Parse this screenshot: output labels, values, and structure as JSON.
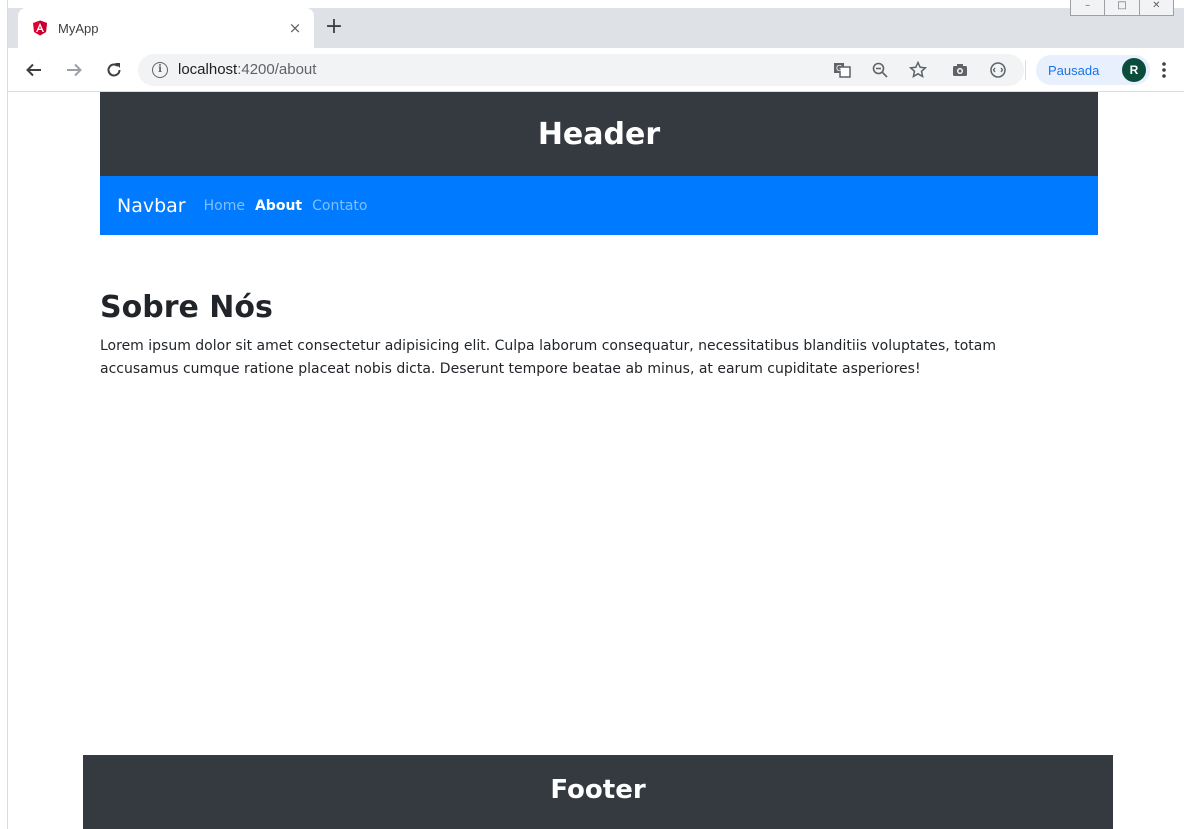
{
  "browser": {
    "tab": {
      "title": "MyApp",
      "close_glyph": "×",
      "favicon": "angular-icon",
      "favicon_color": "#dd0031"
    },
    "new_tab_glyph": "+",
    "window_controls": [
      "–",
      "□",
      "✕"
    ],
    "address": {
      "host": "localhost",
      "rest": ":4200/about",
      "info_glyph": "i"
    },
    "toolbar_icons": [
      "translate-icon",
      "zoom-out-icon",
      "star-icon",
      "camera-icon",
      "extension-icon"
    ],
    "profile": {
      "label": "Pausada",
      "avatar_initial": "R",
      "avatar_color": "#0b4d3c"
    }
  },
  "page": {
    "header": {
      "title": "Header",
      "bg": "#343a40"
    },
    "navbar": {
      "brand": "Navbar",
      "bg": "#007bff",
      "links": [
        {
          "label": "Home",
          "active": false
        },
        {
          "label": "About",
          "active": true
        },
        {
          "label": "Contato",
          "active": false
        }
      ]
    },
    "content": {
      "heading": "Sobre Nós",
      "paragraph": "Lorem ipsum dolor sit amet consectetur adipisicing elit. Culpa laborum consequatur, necessitatibus blanditiis voluptates, totam accusamus cumque ratione placeat nobis dicta. Deserunt tempore beatae ab minus, at earum cupiditate asperiores!"
    },
    "footer": {
      "title": "Footer",
      "bg": "#343a40"
    }
  }
}
